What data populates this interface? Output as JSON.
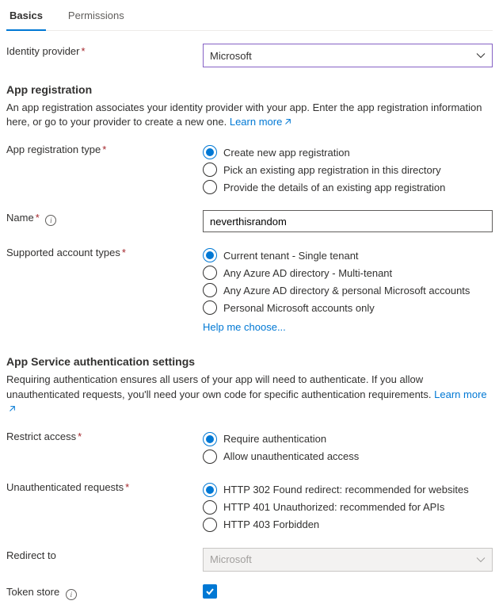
{
  "tabs": {
    "basics": "Basics",
    "permissions": "Permissions"
  },
  "identity_provider": {
    "label": "Identity provider",
    "value": "Microsoft"
  },
  "app_reg": {
    "heading": "App registration",
    "desc": "An app registration associates your identity provider with your app. Enter the app registration information here, or go to your provider to create a new one. ",
    "learn_more": "Learn more",
    "type_label": "App registration type",
    "opts": [
      "Create new app registration",
      "Pick an existing app registration in this directory",
      "Provide the details of an existing app registration"
    ],
    "name_label": "Name",
    "name_value": "neverthisrandom",
    "acct_label": "Supported account types",
    "acct_opts": [
      "Current tenant - Single tenant",
      "Any Azure AD directory - Multi-tenant",
      "Any Azure AD directory & personal Microsoft accounts",
      "Personal Microsoft accounts only"
    ],
    "help_choose": "Help me choose..."
  },
  "auth": {
    "heading": "App Service authentication settings",
    "desc": "Requiring authentication ensures all users of your app will need to authenticate. If you allow unauthenticated requests, you'll need your own code for specific authentication requirements. ",
    "learn_more": "Learn more",
    "restrict_label": "Restrict access",
    "restrict_opts": [
      "Require authentication",
      "Allow unauthenticated access"
    ],
    "unauth_label": "Unauthenticated requests",
    "unauth_opts": [
      "HTTP 302 Found redirect: recommended for websites",
      "HTTP 401 Unauthorized: recommended for APIs",
      "HTTP 403 Forbidden"
    ],
    "redirect_label": "Redirect to",
    "redirect_value": "Microsoft",
    "token_label": "Token store"
  }
}
